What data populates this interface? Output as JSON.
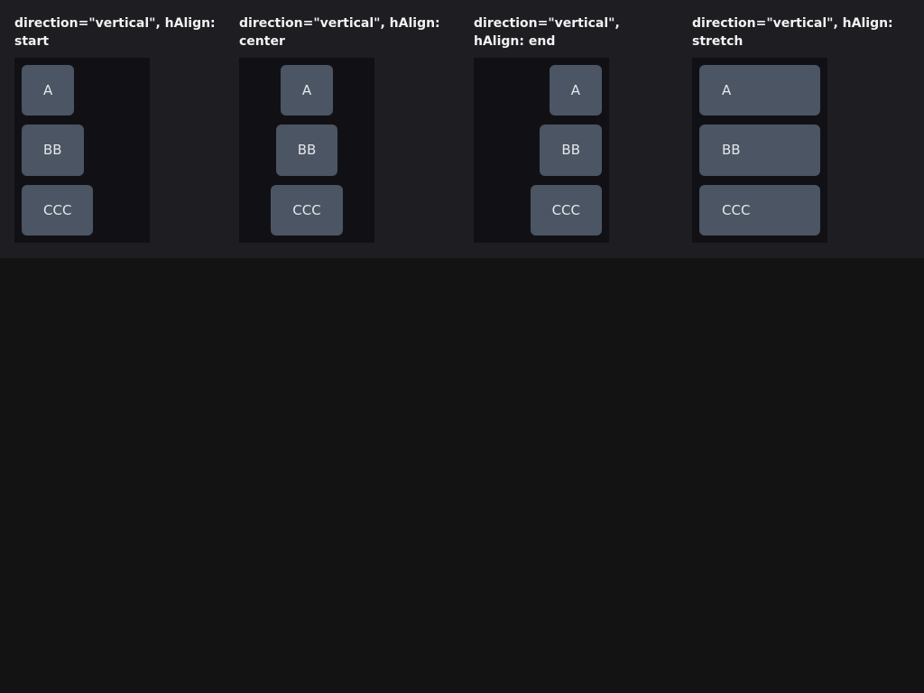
{
  "demos": [
    {
      "title_line1": "direction=\"vertical\", hAlign:",
      "title_line2": "start",
      "items": [
        "A",
        "BB",
        "CCC"
      ]
    },
    {
      "title_line1": "direction=\"vertical\", hAlign:",
      "title_line2": "center",
      "items": [
        "A",
        "BB",
        "CCC"
      ]
    },
    {
      "title_line1": "direction=\"vertical\",",
      "title_line2": "hAlign: end",
      "items": [
        "A",
        "BB",
        "CCC"
      ]
    },
    {
      "title_line1": "direction=\"vertical\", hAlign:",
      "title_line2": "stretch",
      "items": [
        "A",
        "BB",
        "CCC"
      ]
    }
  ],
  "colors": {
    "page_bg": "#131313",
    "header_bg": "#1e1e22",
    "box_bg": "#111115",
    "item_bg": "#4b5563",
    "item_text": "#e5e7eb",
    "title_text": "#f2f2f2"
  }
}
